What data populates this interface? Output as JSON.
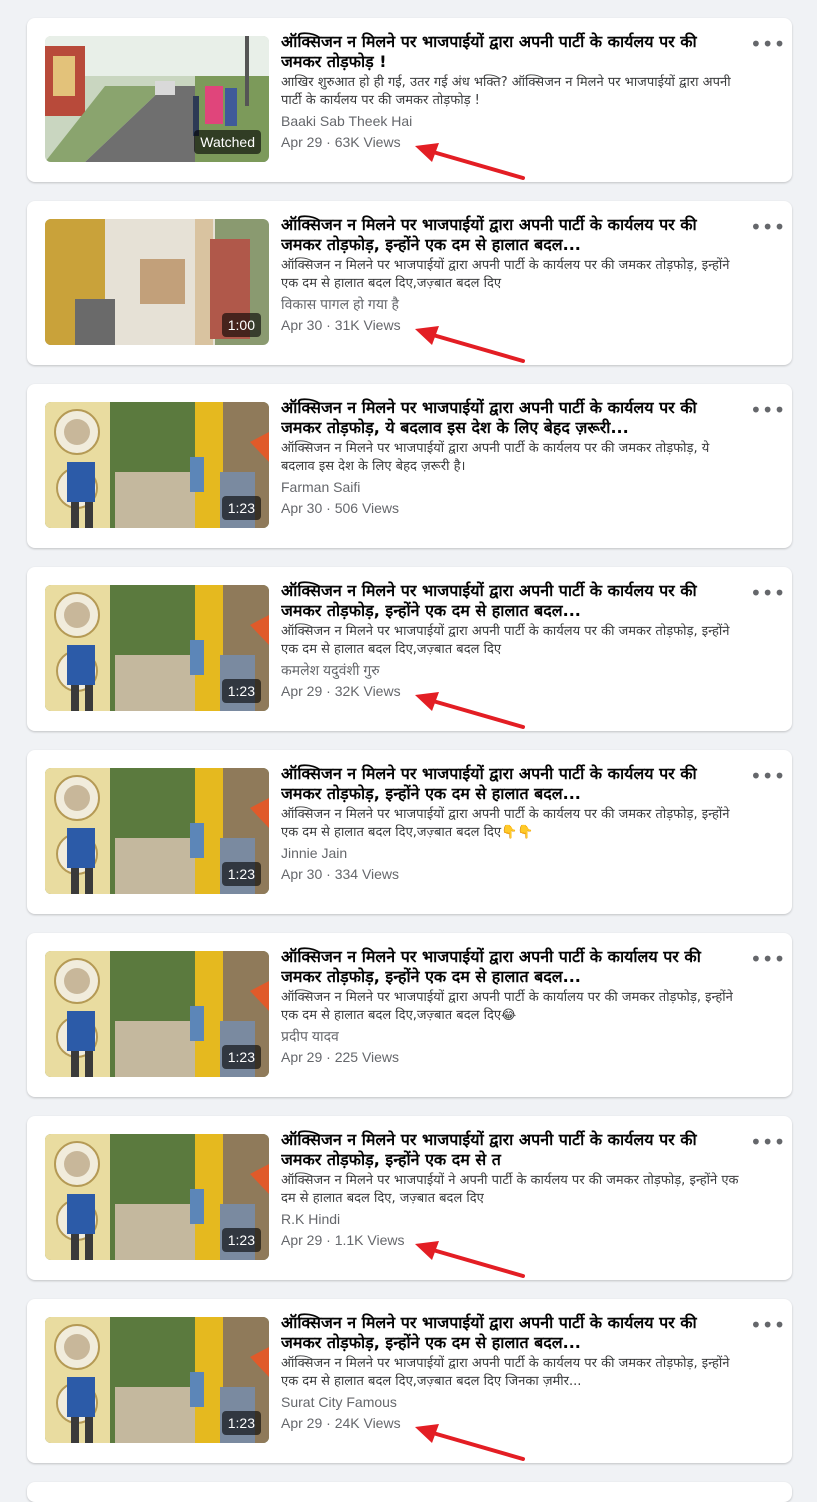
{
  "colors": {
    "arrow": "#e31e24",
    "background": "#f0f2f5",
    "card": "#ffffff"
  },
  "videos": [
    {
      "title": "ऑक्सिजन न मिलने पर भाजपाईयों द्वारा अपनी पार्टी के कार्यलय पर की जमकर तोड़फोड़ !",
      "description": "आखिर शुरुआत हो ही गई, उतर गई अंध भक्ति? ऑक्सिजन न मिलने पर भाजपाईयों द्वारा अपनी पार्टी के कार्यलय पर की जमकर तोड़फोड़ !",
      "channel": "Baaki Sab Theek Hai",
      "meta": "Apr 29 · 63K Views",
      "badge": "Watched"
    },
    {
      "title": "ऑक्सिजन न मिलने पर भाजपाईयों द्वारा अपनी पार्टी के कार्यलय पर की जमकर तोड़फोड़, इन्होंने एक दम से हालात बदल...",
      "description": "ऑक्सिजन न मिलने पर भाजपाईयों द्वारा अपनी पार्टी के कार्यलय पर की जमकर तोड़फोड़, इन्होंने एक दम से हालात बदल दिए,जज़्बात बदल दिए",
      "channel": "विकास पागल हो गया है",
      "meta": "Apr 30 · 31K Views",
      "badge": "1:00"
    },
    {
      "title": "ऑक्सिजन न मिलने पर भाजपाईयों द्वारा अपनी पार्टी के कार्यलय पर की जमकर तोड़फोड़, ये बदलाव इस देश के लिए बेहद ज़रूरी...",
      "description": "ऑक्सिजन न मिलने पर भाजपाईयों द्वारा अपनी पार्टी के कार्यलय पर की जमकर तोड़फोड़, ये बदलाव इस देश के लिए बेहद ज़रूरी है।",
      "channel": "Farman Saifi",
      "meta": "Apr 30 · 506 Views",
      "badge": "1:23"
    },
    {
      "title": "ऑक्सिजन न मिलने पर भाजपाईयों द्वारा अपनी पार्टी के कार्यलय पर की जमकर तोड़फोड़, इन्होंने एक दम से हालात बदल...",
      "description": "ऑक्सिजन न मिलने पर भाजपाईयों द्वारा अपनी पार्टी के कार्यलय पर की जमकर तोड़फोड़, इन्होंने एक दम से हालात बदल दिए,जज़्बात बदल दिए",
      "channel": "कमलेश यदुवंशी गुरु",
      "meta": "Apr 29 · 32K Views",
      "badge": "1:23"
    },
    {
      "title": "ऑक्सिजन न मिलने पर भाजपाईयों द्वारा अपनी पार्टी के कार्यलय पर की जमकर तोड़फोड़, इन्होंने एक दम से हालात बदल...",
      "description": "ऑक्सिजन न मिलने पर भाजपाईयों द्वारा अपनी पार्टी के कार्यलय पर की जमकर तोड़फोड़, इन्होंने एक दम से हालात बदल दिए,जज़्बात बदल दिए👇👇",
      "channel": "Jinnie Jain",
      "meta": "Apr 30 · 334 Views",
      "badge": "1:23"
    },
    {
      "title": "ऑक्सिजन न मिलने पर भाजपाईयों द्वारा अपनी पार्टी के कार्यालय पर की जमकर तोड़फोड़, इन्होंने एक दम से हालात बदल...",
      "description": "ऑक्सिजन न मिलने पर भाजपाईयों द्वारा अपनी पार्टी के कार्यालय पर की जमकर तोड़फोड़, इन्होंने एक दम से हालात बदल दिए,जज़्बात बदल दिए😂",
      "channel": "प्रदीप यादव",
      "meta": "Apr 29 · 225 Views",
      "badge": "1:23"
    },
    {
      "title": "ऑक्सिजन न मिलने पर भाजपाईयों द्वारा अपनी पार्टी के कार्यलय पर की जमकर तोड़फोड़, इन्होंने एक दम से त",
      "description": "ऑक्सिजन न मिलने पर भाजपाईयों ने अपनी पार्टी के कार्यलय पर की जमकर तोड़फोड़, इन्होंने एक दम से हालात बदल दिए, जज़्बात बदल दिए",
      "channel": "R.K Hindi",
      "meta": "Apr 29 · 1.1K Views",
      "badge": "1:23"
    },
    {
      "title": "ऑक्सिजन न मिलने पर भाजपाईयों द्वारा अपनी पार्टी के कार्यलय पर की जमकर तोड़फोड़, इन्होंने एक दम से हालात बदल...",
      "description": "ऑक्सिजन न मिलने पर भाजपाईयों द्वारा अपनी पार्टी के कार्यलय पर की जमकर तोड़फोड़, इन्होंने एक दम से हालात बदल दिए,जज़्बात बदल दिए जिनका ज़मीर...",
      "channel": "Surat City Famous",
      "meta": "Apr 29 · 24K Views",
      "badge": "1:23"
    }
  ]
}
